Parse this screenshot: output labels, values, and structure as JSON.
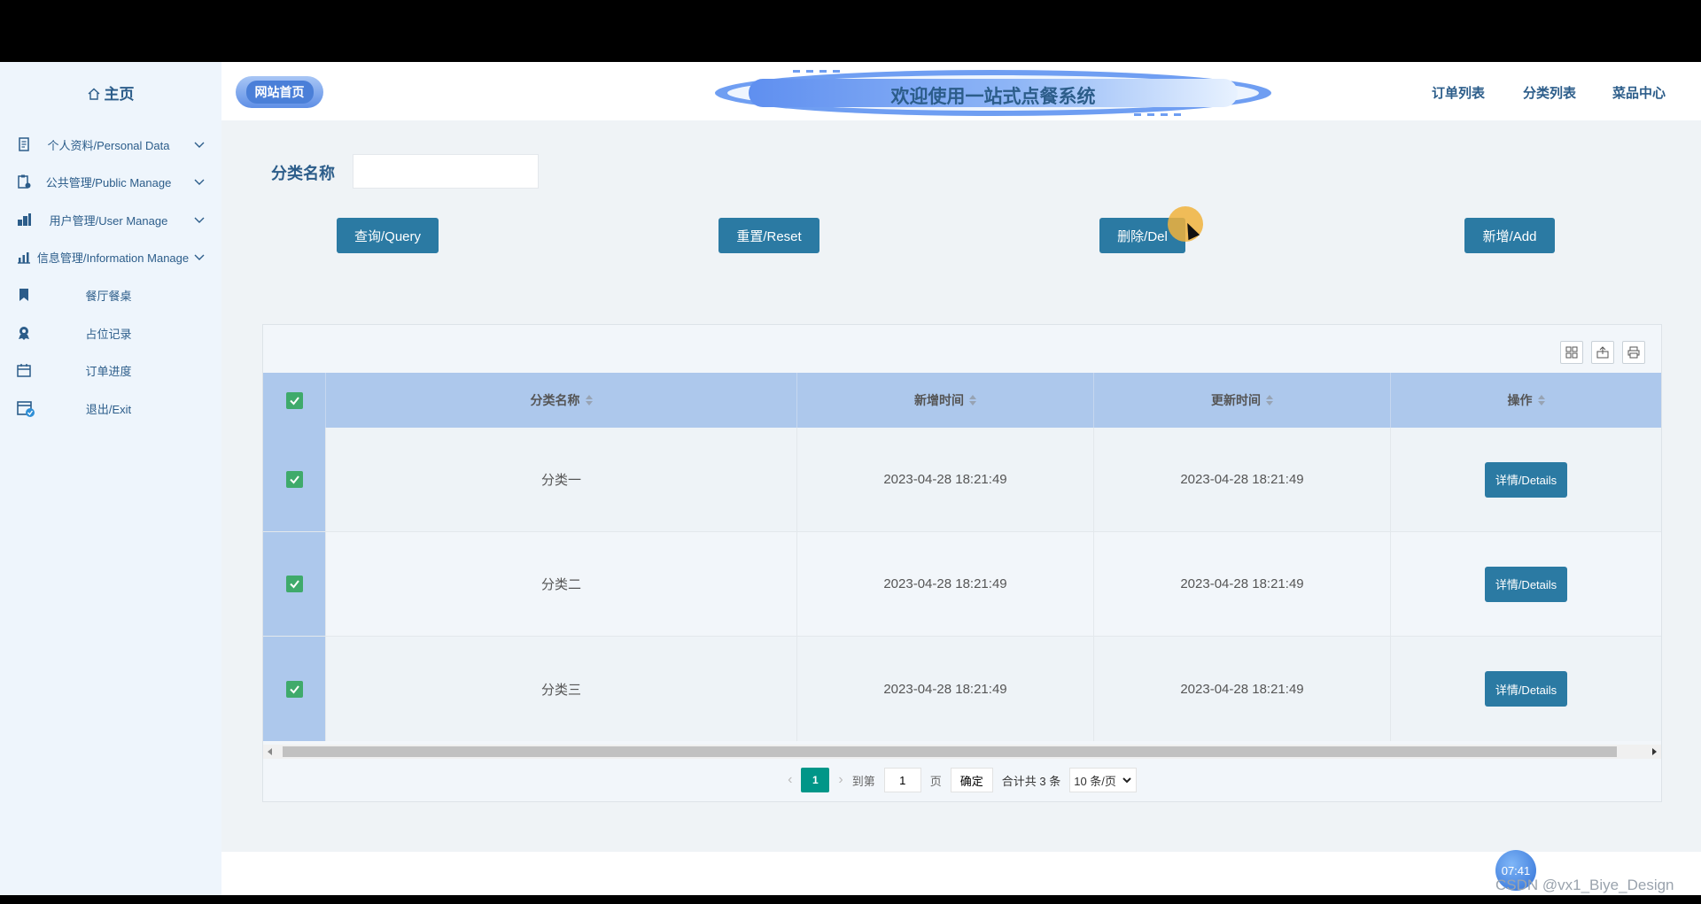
{
  "sidebar": {
    "home_label": "主页",
    "items": [
      {
        "label": "个人资料/Personal Data",
        "icon": "document-icon",
        "expandable": true
      },
      {
        "label": "公共管理/Public Manage",
        "icon": "clipboard-icon",
        "expandable": true
      },
      {
        "label": "用户管理/User Manage",
        "icon": "users-icon",
        "expandable": true
      },
      {
        "label": "信息管理/Information Manage",
        "icon": "chart-icon",
        "expandable": true
      },
      {
        "label": "餐厅餐桌",
        "icon": "bookmark-icon",
        "expandable": false
      },
      {
        "label": "占位记录",
        "icon": "badge-icon",
        "expandable": false
      },
      {
        "label": "订单进度",
        "icon": "calendar-icon",
        "expandable": false
      },
      {
        "label": "退出/Exit",
        "icon": "calendar-check-icon",
        "expandable": false
      }
    ]
  },
  "header": {
    "logo_label": "网站首页",
    "title": "欢迎使用一站式点餐系统",
    "nav": [
      "订单列表",
      "分类列表",
      "菜品中心"
    ]
  },
  "search": {
    "label": "分类名称",
    "value": "",
    "placeholder": ""
  },
  "actions": {
    "query": "查询/Query",
    "reset": "重置/Reset",
    "delete": "删除/Del",
    "add": "新增/Add"
  },
  "table": {
    "columns": [
      "分类名称",
      "新增时间",
      "更新时间",
      "操作"
    ],
    "rows": [
      {
        "name": "分类一",
        "created": "2023-04-28 18:21:49",
        "updated": "2023-04-28 18:21:49",
        "action": "详情/Details",
        "checked": true
      },
      {
        "name": "分类二",
        "created": "2023-04-28 18:21:49",
        "updated": "2023-04-28 18:21:49",
        "action": "详情/Details",
        "checked": true
      },
      {
        "name": "分类三",
        "created": "2023-04-28 18:21:49",
        "updated": "2023-04-28 18:21:49",
        "action": "详情/Details",
        "checked": true
      }
    ],
    "header_checked": true
  },
  "pager": {
    "current": "1",
    "goto_label": "到第",
    "goto_value": "1",
    "page_unit": "页",
    "confirm": "确定",
    "total": "合计共 3 条",
    "page_size": "10 条/页"
  },
  "overlay": {
    "clock": "07:41",
    "watermark": "CSDN @vx1_Biye_Design"
  },
  "colors": {
    "accent": "#2b7aa3",
    "sidebar_bg": "#eef5fc",
    "header_row": "#adc8ec",
    "check": "#3faa6b",
    "pager_current": "#009688"
  }
}
